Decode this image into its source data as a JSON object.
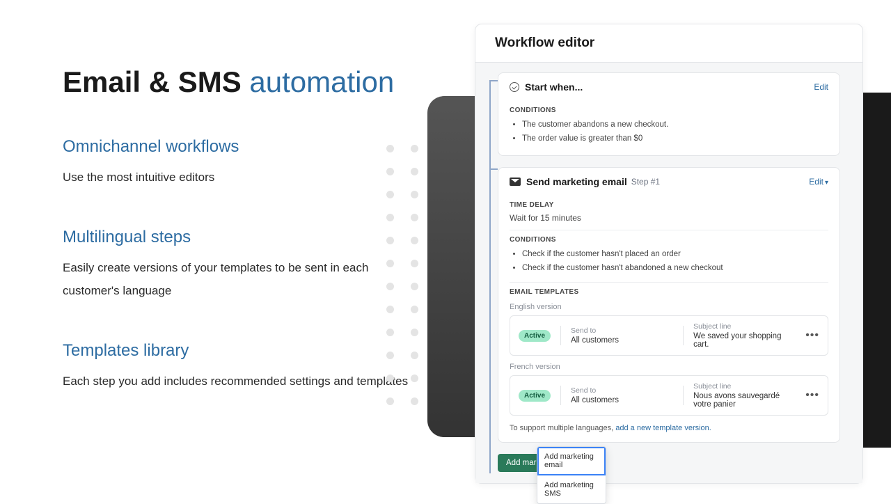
{
  "heading": {
    "main": "Email & SMS",
    "accent": "automation"
  },
  "features": [
    {
      "title": "Omnichannel workflows",
      "desc": "Use the most intuitive editors"
    },
    {
      "title": "Multilingual steps",
      "desc": "Easily create versions of your templates to be sent in each customer's language"
    },
    {
      "title": "Templates library",
      "desc": "Each step you add includes recommended settings and templates"
    }
  ],
  "editor": {
    "title": "Workflow editor",
    "start": {
      "label": "Start when...",
      "edit": "Edit",
      "conditions_label": "CONDITIONS",
      "conditions": [
        "The customer abandons a new checkout.",
        "The order value is greater than $0"
      ]
    },
    "step1": {
      "title": "Send marketing email",
      "step": "Step #1",
      "edit": "Edit",
      "time_delay_label": "TIME DELAY",
      "time_delay_value": "Wait for 15 minutes",
      "conditions_label": "CONDITIONS",
      "conditions": [
        "Check if the customer hasn't placed an order",
        "Check if the customer hasn't abandoned a new checkout"
      ],
      "templates_label": "EMAIL TEMPLATES",
      "versions": [
        {
          "lang": "English version",
          "status": "Active",
          "send_to_label": "Send to",
          "send_to": "All customers",
          "subject_label": "Subject line",
          "subject": "We saved your shopping cart."
        },
        {
          "lang": "French version",
          "status": "Active",
          "send_to_label": "Send to",
          "send_to": "All customers",
          "subject_label": "Subject line",
          "subject": "Nous avons sauvegardé votre panier"
        }
      ],
      "support_prefix": "To support multiple languages, ",
      "support_link": "add a new template version."
    },
    "add_button": "Add marketing activity",
    "dropdown": [
      "Add marketing email",
      "Add marketing SMS"
    ]
  }
}
